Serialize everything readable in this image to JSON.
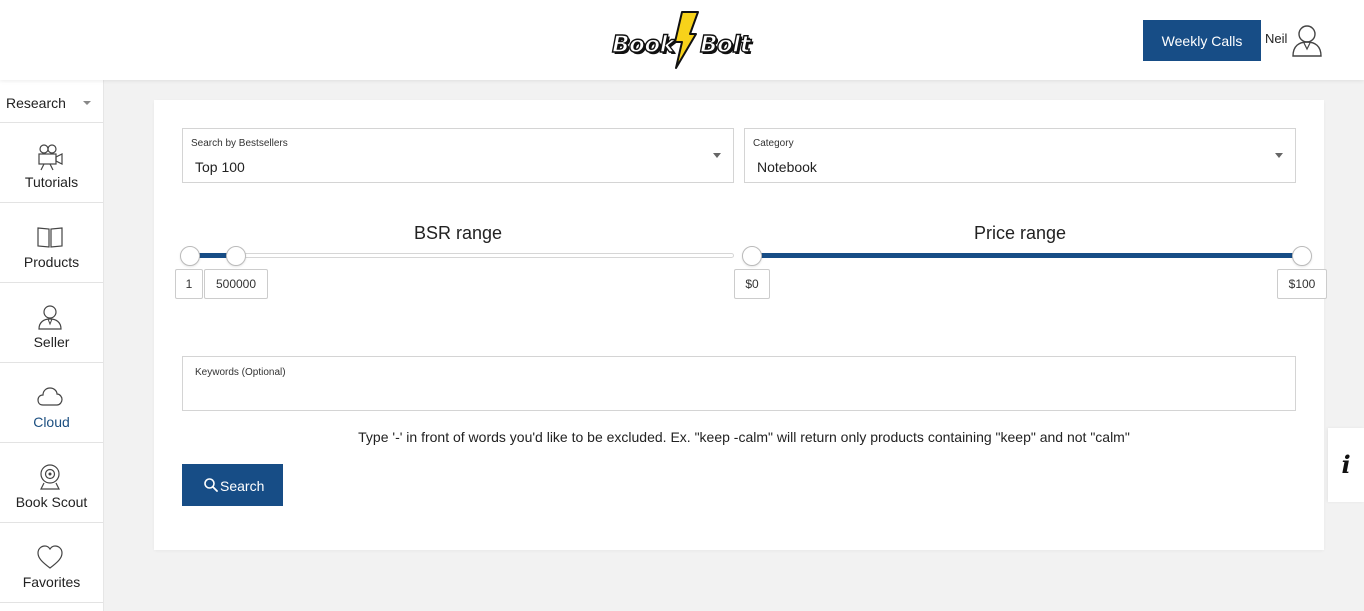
{
  "header": {
    "logo_left": "Book",
    "logo_right": "Bolt",
    "weekly_calls_label": "Weekly Calls",
    "user_name": "Neil"
  },
  "sidebar": {
    "dropdown_label": "Research",
    "items": [
      {
        "label": "Tutorials",
        "icon": "camera-icon"
      },
      {
        "label": "Products",
        "icon": "book-icon"
      },
      {
        "label": "Seller",
        "icon": "seller-icon"
      },
      {
        "label": "Cloud",
        "icon": "cloud-icon",
        "active": true
      },
      {
        "label": "Book Scout",
        "icon": "webcam-icon"
      },
      {
        "label": "Favorites",
        "icon": "heart-icon"
      }
    ]
  },
  "filters": {
    "bestsellers": {
      "label": "Search by Bestsellers",
      "value": "Top 100"
    },
    "category": {
      "label": "Category",
      "value": "Notebook"
    }
  },
  "bsr_range": {
    "title": "BSR range",
    "min_value": "1",
    "max_value": "500000"
  },
  "price_range": {
    "title": "Price range",
    "min_value": "$0",
    "max_value": "$100"
  },
  "keywords": {
    "label": "Keywords (Optional)",
    "value": ""
  },
  "hint_text": "Type '-' in front of words you'd like to be excluded. Ex. \"keep -calm\" will return only products containing \"keep\" and not \"calm\"",
  "search_label": "Search",
  "info_label": "i",
  "colors": {
    "primary": "#174d86",
    "logo_bolt": "#f7d21a"
  }
}
